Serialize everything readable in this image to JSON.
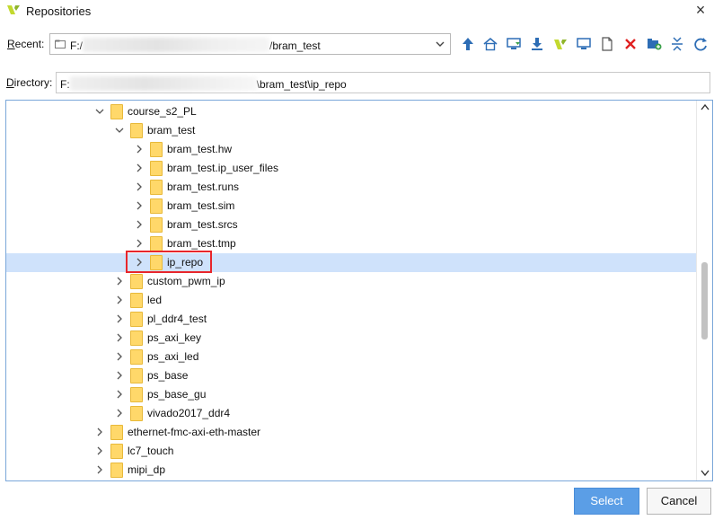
{
  "window": {
    "title": "Repositories",
    "close_icon": "close-icon"
  },
  "recent": {
    "label_underlined": "R",
    "label_rest": "ecent:",
    "value_prefix": "F:/",
    "value_suffix": "/bram_test"
  },
  "toolbar": {
    "icons": [
      "arrow-up-icon",
      "home-icon",
      "desktop-download-icon",
      "download-icon",
      "vivado-logo-icon",
      "monitor-icon",
      "new-file-icon",
      "delete-icon",
      "new-folder-icon",
      "collapse-all-icon",
      "refresh-icon"
    ]
  },
  "directory": {
    "label_underlined": "D",
    "label_rest": "irectory:",
    "value_prefix": "F:",
    "value_suffix": "\\bram_test\\ip_repo"
  },
  "tree": {
    "nodes": [
      {
        "label": "course_s2_PL",
        "expanded": true,
        "level": 1
      },
      {
        "label": "bram_test",
        "expanded": true,
        "level": 2
      },
      {
        "label": "bram_test.hw",
        "expanded": false,
        "level": 3
      },
      {
        "label": "bram_test.ip_user_files",
        "expanded": false,
        "level": 3
      },
      {
        "label": "bram_test.runs",
        "expanded": false,
        "level": 3
      },
      {
        "label": "bram_test.sim",
        "expanded": false,
        "level": 3
      },
      {
        "label": "bram_test.srcs",
        "expanded": false,
        "level": 3
      },
      {
        "label": "bram_test.tmp",
        "expanded": false,
        "level": 3
      },
      {
        "label": "ip_repo",
        "expanded": false,
        "level": 3,
        "selected": true
      },
      {
        "label": "custom_pwm_ip",
        "expanded": false,
        "level": 2
      },
      {
        "label": "led",
        "expanded": false,
        "level": 2
      },
      {
        "label": "pl_ddr4_test",
        "expanded": false,
        "level": 2
      },
      {
        "label": "ps_axi_key",
        "expanded": false,
        "level": 2
      },
      {
        "label": "ps_axi_led",
        "expanded": false,
        "level": 2
      },
      {
        "label": "ps_base",
        "expanded": false,
        "level": 2
      },
      {
        "label": "ps_base_gu",
        "expanded": false,
        "level": 2
      },
      {
        "label": "vivado2017_ddr4",
        "expanded": false,
        "level": 2
      },
      {
        "label": "ethernet-fmc-axi-eth-master",
        "expanded": false,
        "level": 1
      },
      {
        "label": "lc7_touch",
        "expanded": false,
        "level": 1
      },
      {
        "label": "mipi_dp",
        "expanded": false,
        "level": 1
      }
    ]
  },
  "buttons": {
    "select": "Select",
    "cancel": "Cancel"
  },
  "colors": {
    "selection": "#cfe2fb",
    "folder": "#ffd86a",
    "primary_button": "#5b9ee6",
    "highlight_box": "#e8262b"
  }
}
